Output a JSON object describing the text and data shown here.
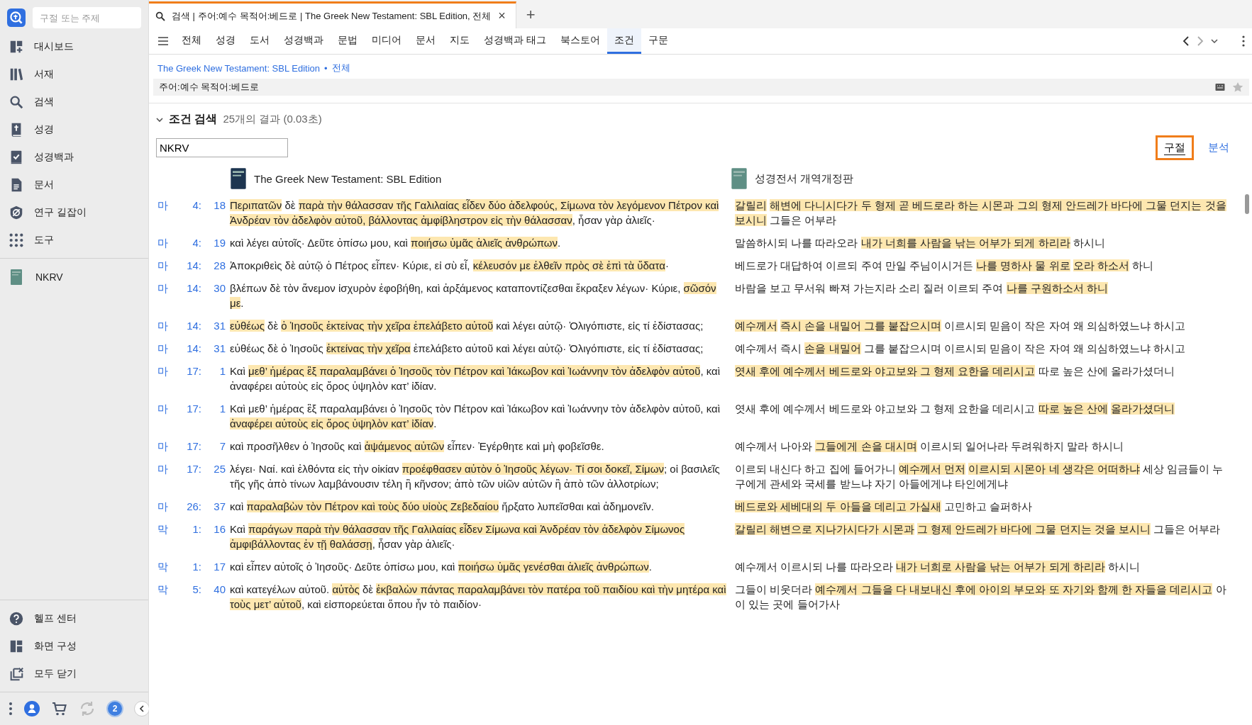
{
  "sidebar": {
    "search": {
      "placeholder": "구절 또는 주제"
    },
    "items": [
      {
        "label": "대시보드"
      },
      {
        "label": "서재"
      },
      {
        "label": "검색"
      },
      {
        "label": "성경"
      },
      {
        "label": "성경백과"
      },
      {
        "label": "문서"
      },
      {
        "label": "연구 길잡이"
      },
      {
        "label": "도구"
      }
    ],
    "resources": [
      {
        "label": "NKRV"
      }
    ],
    "bottom_items": [
      {
        "label": "헬프 센터"
      },
      {
        "label": "화면 구성"
      },
      {
        "label": "모두 닫기"
      }
    ],
    "badge": "2"
  },
  "document_tab": {
    "title": "검색 | 주어:예수 목적어:베드로 | The Greek New Testament: SBL Edition, 전체",
    "close": "×",
    "add": "+"
  },
  "nav_tabs": [
    {
      "label": "전체",
      "selected": false
    },
    {
      "label": "성경",
      "selected": false
    },
    {
      "label": "도서",
      "selected": false
    },
    {
      "label": "성경백과",
      "selected": false
    },
    {
      "label": "문법",
      "selected": false
    },
    {
      "label": "미디어",
      "selected": false
    },
    {
      "label": "문서",
      "selected": false
    },
    {
      "label": "지도",
      "selected": false
    },
    {
      "label": "성경백과 태그",
      "selected": false
    },
    {
      "label": "북스토어",
      "selected": false
    },
    {
      "label": "조건",
      "selected": true
    },
    {
      "label": "구문",
      "selected": false
    }
  ],
  "breadcrumb": {
    "resource": "The Greek New Testament: SBL Edition",
    "separator": "•",
    "scope": "전체"
  },
  "query": "주어:예수 목적어:베드로",
  "heading": {
    "title": "조건 검색",
    "summary": "25개의 결과 (0.03초)"
  },
  "filter_field": {
    "value": "NKRV"
  },
  "view_toggle": [
    {
      "label": "구절",
      "selected": true
    },
    {
      "label": "분석",
      "selected": false
    }
  ],
  "columns": [
    {
      "title": "The Greek New Testament: SBL Edition"
    },
    {
      "title": "성경전서 개역개정판"
    }
  ],
  "rows": [
    {
      "book": "마",
      "chapter": "4:",
      "verse": "18",
      "greek": [
        {
          "text": "Περιπατῶν",
          "highlighted": true
        },
        {
          "text": " δὲ ",
          "highlighted": false
        },
        {
          "text": "παρὰ τὴν θάλασσαν τῆς Γαλιλαίας εἶδεν δύο ἀδελφούς, Σίμωνα τὸν λεγόμενον Πέτρον καὶ Ἀνδρέαν τὸν ἀδελφὸν αὐτοῦ, βάλλοντας ἀμφίβληστρον εἰς τὴν θάλασσαν",
          "highlighted": true
        },
        {
          "text": ", ἦσαν γὰρ ἁλιεῖς·",
          "highlighted": false
        }
      ],
      "korean": [
        {
          "text": "갈릴리",
          "highlighted": true
        },
        {
          "text": "해변에 다니시다가 두 형제 곧 베드로라 하는 시몬과 그의 형제 안드레가 바다에 그물 던지는 것을 보시니",
          "highlighted": true
        },
        {
          "text": " 그들은 어부라",
          "highlighted": false
        }
      ]
    },
    {
      "book": "마",
      "chapter": "4:",
      "verse": "19",
      "greek": [
        {
          "text": "καὶ λέγει αὐτοῖς· Δεῦτε ὀπίσω μου, καὶ ",
          "highlighted": false
        },
        {
          "text": "ποιήσω ὑμᾶς ἁλιεῖς ἀνθρώπων",
          "highlighted": true
        },
        {
          "text": ".",
          "highlighted": false
        }
      ],
      "korean": [
        {
          "text": "말씀하시되 나를 따라오라 ",
          "highlighted": false
        },
        {
          "text": "내가 너희를 사람을 낚는 어부가 되게 하리라",
          "highlighted": true
        },
        {
          "text": " 하시니",
          "highlighted": false
        }
      ]
    },
    {
      "book": "마",
      "chapter": "14:",
      "verse": "28",
      "greek": [
        {
          "text": "Ἀποκριθεὶς δὲ αὐτῷ ὁ Πέτρος εἶπεν· Κύριε, εἰ σὺ εἶ, ",
          "highlighted": false
        },
        {
          "text": "κέλευσόν με ἐλθεῖν πρὸς σὲ ἐπὶ τὰ ὕδατα",
          "highlighted": true
        },
        {
          "text": "·",
          "highlighted": false
        }
      ],
      "korean": [
        {
          "text": "베드로가 대답하여 이르되 주여 만일 주님이시거든 ",
          "highlighted": false
        },
        {
          "text": "나를 명하사 물 위로",
          "highlighted": true
        },
        {
          "text": "오라 하소서",
          "highlighted": true
        },
        {
          "text": " 하니",
          "highlighted": false
        }
      ]
    },
    {
      "book": "마",
      "chapter": "14:",
      "verse": "30",
      "greek": [
        {
          "text": "βλέπων δὲ τὸν ἄνεμον ἰσχυρὸν ἐφοβήθη, καὶ ἀρξάμενος καταποντίζεσθαι ἔκραξεν λέγων· Κύριε, ",
          "highlighted": false
        },
        {
          "text": "σῶσόν με",
          "highlighted": true
        },
        {
          "text": ".",
          "highlighted": false
        }
      ],
      "korean": [
        {
          "text": "바람을 보고 무서워 빠져 가는지라 소리 질러 이르되 주여 ",
          "highlighted": false
        },
        {
          "text": "나를 구원하소서 하니",
          "highlighted": true
        }
      ]
    },
    {
      "book": "마",
      "chapter": "14:",
      "verse": "31",
      "greek": [
        {
          "text": "εὐθέως",
          "highlighted": true
        },
        {
          "text": " δὲ ",
          "highlighted": false
        },
        {
          "text": "ὁ Ἰησοῦς ἐκτείνας τὴν χεῖρα ἐπελάβετο αὐτοῦ",
          "highlighted": true
        },
        {
          "text": " καὶ λέγει αὐτῷ· Ὀλιγόπιστε, εἰς τί ἐδίστασας;",
          "highlighted": false
        }
      ],
      "korean": [
        {
          "text": "예수께서",
          "highlighted": true
        },
        {
          "text": "즉시 손을 내밀어 그를 붙잡으시며",
          "highlighted": true
        },
        {
          "text": " 이르시되 믿음이 작은 자여 왜 의심하였느냐 하시고",
          "highlighted": false
        }
      ]
    },
    {
      "book": "마",
      "chapter": "14:",
      "verse": "31",
      "greek": [
        {
          "text": "εὐθέως δὲ ὁ Ἰησοῦς ",
          "highlighted": false
        },
        {
          "text": "ἐκτείνας τὴν χεῖρα",
          "highlighted": true
        },
        {
          "text": " ἐπελάβετο αὐτοῦ καὶ λέγει αὐτῷ· Ὀλιγόπιστε, εἰς τί ἐδίστασας;",
          "highlighted": false
        }
      ],
      "korean": [
        {
          "text": "예수께서 즉시 ",
          "highlighted": false
        },
        {
          "text": "손을 내밀어",
          "highlighted": true
        },
        {
          "text": " 그를 붙잡으시며 이르시되 믿음이 작은 자여 왜 의심하였느냐 하시고",
          "highlighted": false
        }
      ]
    },
    {
      "book": "마",
      "chapter": "17:",
      "verse": "1",
      "greek": [
        {
          "text": "Καὶ ",
          "highlighted": false
        },
        {
          "text": "μεθ’ ἡμέρας ἓξ παραλαμβάνει ὁ Ἰησοῦς τὸν Πέτρον καὶ Ἰάκωβον καὶ Ἰωάννην τὸν ἀδελφὸν αὐτοῦ",
          "highlighted": true
        },
        {
          "text": ", καὶ ἀναφέρει αὐτοὺς εἰς ὄρος ὑψηλὸν κατ’ ἰδίαν.",
          "highlighted": false
        }
      ],
      "korean": [
        {
          "text": "엿새 후에 예수께서 베드로와 야고보와 그 형제 요한을 데리시고",
          "highlighted": true
        },
        {
          "text": " 따로 높은 산에 올라가셨더니",
          "highlighted": false
        }
      ]
    },
    {
      "book": "마",
      "chapter": "17:",
      "verse": "1",
      "greek": [
        {
          "text": "Καὶ μεθ’ ἡμέρας ἓξ παραλαμβάνει ὁ Ἰησοῦς τὸν Πέτρον καὶ Ἰάκωβον καὶ Ἰωάννην τὸν ἀδελφὸν αὐτοῦ, καὶ ",
          "highlighted": false
        },
        {
          "text": "ἀναφέρει αὐτοὺς εἰς ὄρος ὑψηλὸν κατ’ ἰδίαν",
          "highlighted": true
        },
        {
          "text": ".",
          "highlighted": false
        }
      ],
      "korean": [
        {
          "text": "엿새 후에 예수께서 베드로와 야고보와 그 형제 요한을 데리시고 ",
          "highlighted": false
        },
        {
          "text": "따로 높은 산에",
          "highlighted": true
        },
        {
          "text": "올라가셨더니",
          "highlighted": true
        }
      ]
    },
    {
      "book": "마",
      "chapter": "17:",
      "verse": "7",
      "greek": [
        {
          "text": "καὶ προσῆλθεν ὁ Ἰησοῦς καὶ ",
          "highlighted": false
        },
        {
          "text": "ἁψάμενος αὐτῶν",
          "highlighted": true
        },
        {
          "text": " εἶπεν· Ἐγέρθητε καὶ μὴ φοβεῖσθε.",
          "highlighted": false
        }
      ],
      "korean": [
        {
          "text": "예수께서 나아와 ",
          "highlighted": false
        },
        {
          "text": "그들에게 손을 대시며",
          "highlighted": true
        },
        {
          "text": " 이르시되 일어나라 두려워하지 말라 하시니",
          "highlighted": false
        }
      ]
    },
    {
      "book": "마",
      "chapter": "17:",
      "verse": "25",
      "greek": [
        {
          "text": "λέγει· Ναί. καὶ ἐλθόντα εἰς τὴν οἰκίαν ",
          "highlighted": false
        },
        {
          "text": "προέφθασεν αὐτὸν ὁ Ἰησοῦς λέγων· Τί σοι δοκεῖ, Σίμων",
          "highlighted": true
        },
        {
          "text": "; οἱ βασιλεῖς τῆς γῆς ἀπὸ τίνων λαμβάνουσιν τέλη ἢ κῆνσον; ἀπὸ τῶν υἱῶν αὐτῶν ἢ ἀπὸ τῶν ἀλλοτρίων;",
          "highlighted": false
        }
      ],
      "korean": [
        {
          "text": "이르되 내신다 하고 집에 들어가니 ",
          "highlighted": false
        },
        {
          "text": "예수께서 먼저",
          "highlighted": true
        },
        {
          "text": "이르시되 시몬아 네 생각은 어떠하냐",
          "highlighted": true
        },
        {
          "text": " 세상 임금들이 누구에게 관세와 국세를 받느냐 자기 아들에게냐 타인에게냐",
          "highlighted": false
        }
      ]
    },
    {
      "book": "마",
      "chapter": "26:",
      "verse": "37",
      "greek": [
        {
          "text": "καὶ ",
          "highlighted": false
        },
        {
          "text": "παραλαβὼν τὸν Πέτρον καὶ τοὺς δύο υἱοὺς Ζεβεδαίου",
          "highlighted": true
        },
        {
          "text": " ἤρξατο λυπεῖσθαι καὶ ἀδημονεῖν.",
          "highlighted": false
        }
      ],
      "korean": [
        {
          "text": "베드로와 세베대의 두 아들을 데리고 가실새",
          "highlighted": true
        },
        {
          "text": " 고민하고 슬퍼하사",
          "highlighted": false
        }
      ]
    },
    {
      "book": "막",
      "chapter": "1:",
      "verse": "16",
      "greek": [
        {
          "text": "Καὶ ",
          "highlighted": false
        },
        {
          "text": "παράγων παρὰ τὴν θάλασσαν τῆς Γαλιλαίας εἶδεν Σίμωνα καὶ Ἀνδρέαν τὸν ἀδελφὸν Σίμωνος ἀμφιβάλλοντας ἐν τῇ θαλάσσῃ",
          "highlighted": true
        },
        {
          "text": ", ἦσαν γὰρ ἁλιεῖς·",
          "highlighted": false
        }
      ],
      "korean": [
        {
          "text": "갈릴리 해변으로 지나가시다가 시몬과",
          "highlighted": true
        },
        {
          "text": "그 형제 안드레가 바다에 그물 던지는 것을 보시니",
          "highlighted": true
        },
        {
          "text": " 그들은 어부라",
          "highlighted": false
        }
      ]
    },
    {
      "book": "막",
      "chapter": "1:",
      "verse": "17",
      "greek": [
        {
          "text": "καὶ εἶπεν αὐτοῖς ὁ Ἰησοῦς· Δεῦτε ὀπίσω μου, καὶ ",
          "highlighted": false
        },
        {
          "text": "ποιήσω ὑμᾶς γενέσθαι ἁλιεῖς ἀνθρώπων",
          "highlighted": true
        },
        {
          "text": ".",
          "highlighted": false
        }
      ],
      "korean": [
        {
          "text": "예수께서 이르시되 나를 따라오라 ",
          "highlighted": false
        },
        {
          "text": "내가 너희로 사람을 낚는 어부가 되게 하리라",
          "highlighted": true
        },
        {
          "text": " 하시니",
          "highlighted": false
        }
      ]
    },
    {
      "book": "막",
      "chapter": "5:",
      "verse": "40",
      "greek": [
        {
          "text": "καὶ κατεγέλων αὐτοῦ. ",
          "highlighted": false
        },
        {
          "text": "αὐτὸς",
          "highlighted": true
        },
        {
          "text": " δὲ ",
          "highlighted": false
        },
        {
          "text": "ἐκβαλὼν πάντας παραλαμβάνει τὸν πατέρα τοῦ παιδίου καὶ τὴν μητέρα καὶ τοὺς μετ’ αὐτοῦ",
          "highlighted": true
        },
        {
          "text": ", καὶ εἰσπορεύεται ὅπου ἦν τὸ παιδίον·",
          "highlighted": false
        }
      ],
      "korean": [
        {
          "text": "그들이 비웃더라 ",
          "highlighted": false
        },
        {
          "text": "예수께서 그들을 다 내보내신 후에 아이의 부모와 또 자기와 함께 한 자들을 데리시고",
          "highlighted": true
        },
        {
          "text": " 아이 있는 곳에 들어가사",
          "highlighted": false
        }
      ]
    }
  ]
}
